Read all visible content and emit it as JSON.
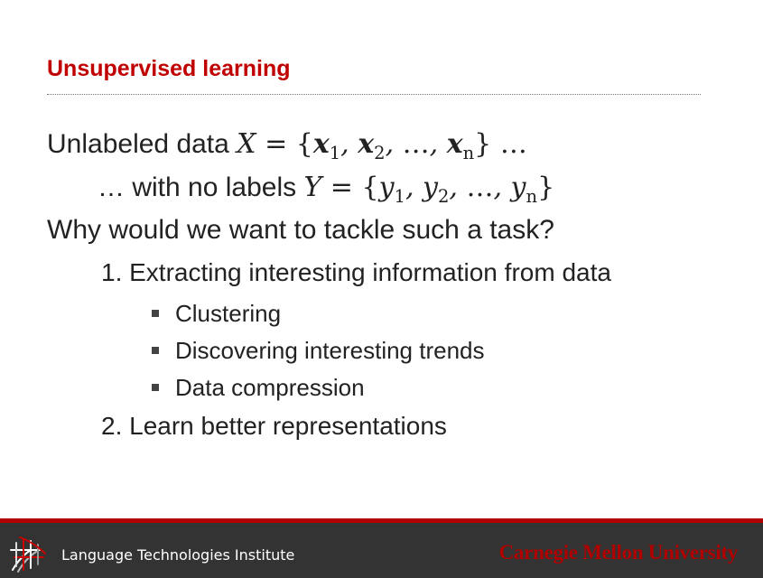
{
  "slide": {
    "title": "Unsupervised learning",
    "lines": {
      "unlabeled_prefix": "Unlabeled data ",
      "unlabeled_math": "X = {x1, x2, …, xn} …",
      "nolabels_prefix": "… with no labels ",
      "nolabels_math": "Y = {y1, y2, …, yn}",
      "question": "Why would we want to tackle such a task?",
      "point1": "1. Extracting interesting information from data",
      "bullets": [
        "Clustering",
        "Discovering interesting trends",
        "Data compression"
      ],
      "point2": "2. Learn better representations"
    }
  },
  "footer": {
    "institute": "Language Technologies Institute",
    "university": "Carnegie Mellon University"
  },
  "colors": {
    "title": "#c00000",
    "footer_bg": "#333333",
    "footer_rule": "#b00000",
    "cmu_text": "#b00000"
  },
  "icons": [
    "lti-logo-icon",
    "bullet-square-icon"
  ]
}
